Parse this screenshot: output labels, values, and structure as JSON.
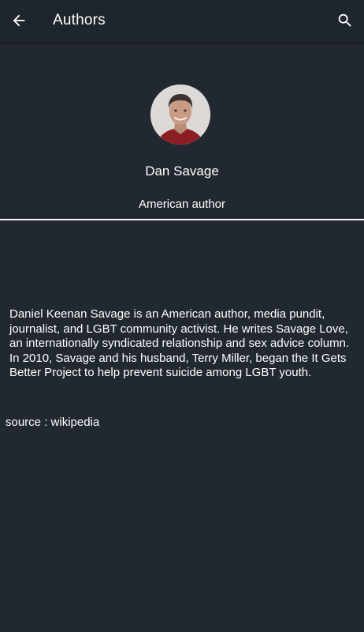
{
  "app_bar": {
    "title": "Authors",
    "back_icon": "arrow-back-icon",
    "search_icon": "search-icon"
  },
  "author": {
    "name": "Dan Savage",
    "role": "American author",
    "bio": "Daniel Keenan Savage is an American author, media pundit, journalist, and LGBT community activist. He writes Savage Love, an internationally syndicated relationship and sex advice column. In 2010, Savage and his husband, Terry Miller, began the It Gets Better Project to help prevent suicide among LGBT youth.",
    "source": "source : wikipedia"
  },
  "colors": {
    "background": "#222830",
    "app_bar": "#1f252c",
    "text": "#ffffff",
    "divider": "#f2f2f2"
  }
}
